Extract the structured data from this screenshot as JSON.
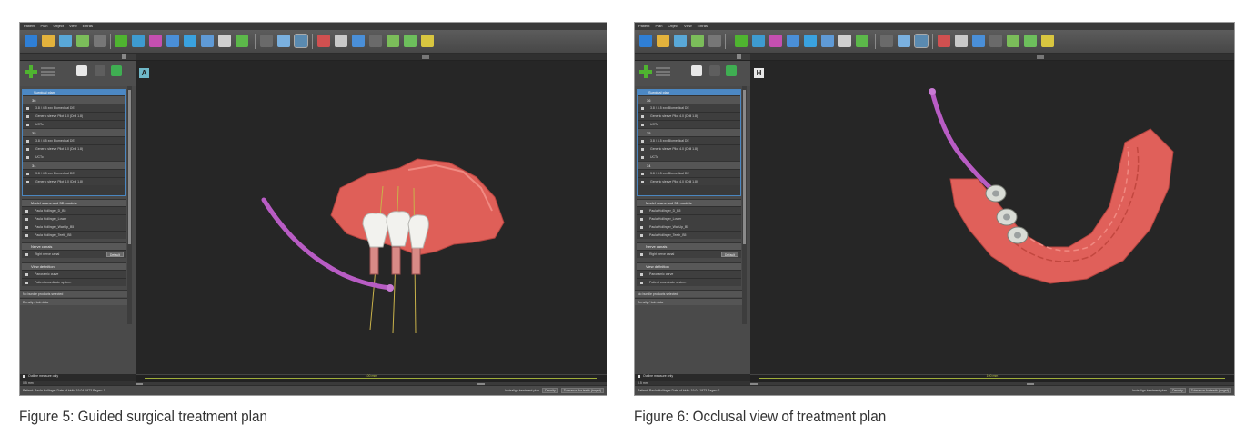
{
  "panels": [
    {
      "caption": "Figure 5: Guided surgical treatment plan",
      "view_label": "A",
      "scale_label": "100 mm",
      "unit_value": "0.5 mm",
      "checkbox_label": "Outline measure only",
      "menu": [
        "Patient",
        "Plan",
        "Object",
        "View",
        "Extras"
      ],
      "tab_label": "Plan",
      "plan_header": "Surgical plan",
      "groups": [
        {
          "label": "36",
          "rows": [
            "3.8 / 4.5  xxx Biomedical DE",
            "Generic sleeve Pilot 4.0 (Drill 1.8)",
            "UCTo"
          ]
        },
        {
          "label": "35",
          "rows": [
            "3.8 / 4.5  xxx Biomedical DE",
            "Generic sleeve Pilot 4.0 (Drill 1.8)",
            "UCTo"
          ]
        },
        {
          "label": "34",
          "rows": [
            "3.8 / 4.5  xxx Biomedical DE",
            "Generic sleeve Pilot 4.0 (Drill 1.8)",
            "UCTo"
          ]
        }
      ],
      "model_header": "Model scans and 3D models",
      "models": [
        "Paula Hollinger_D_B5",
        "Paula Hollinger_Lower",
        "Paula Hollinger_WaxUp_B5",
        "Paula Hollinger_Teeth_B5"
      ],
      "nerve_header": "Nerve canals",
      "nerve_row": "Right nerve canal",
      "default_button": "Default",
      "view_header": "View definition",
      "view_rows": [
        "Panoramic curve",
        "Patient coordinate system"
      ],
      "collapsed": [
        "No bundle products selected",
        "Density / Lab data"
      ],
      "status_left": "Patient: Paula Hollinger   Date of birth: 19.04.1973   Pages: 1",
      "status_right": "Invisalign treatment plan",
      "status_b1": "Density",
      "status_b2": "Tolerance for teeth (target)",
      "status_slice": "Images: 1 of 1"
    },
    {
      "caption": "Figure 6: Occlusal view of treatment plan",
      "view_label": "H",
      "scale_label": "100 mm",
      "unit_value": "0.5 mm",
      "checkbox_label": "Outline measure only",
      "menu": [
        "Patient",
        "Plan",
        "Object",
        "View",
        "Extras"
      ],
      "tab_label": "Plan",
      "plan_header": "Surgical plan",
      "groups": [
        {
          "label": "36",
          "rows": [
            "3.8 / 4.5  xxx Biomedical DE",
            "Generic sleeve Pilot 4.0 (Drill 1.8)",
            "UCTo"
          ]
        },
        {
          "label": "35",
          "rows": [
            "3.8 / 4.5  xxx Biomedical DE",
            "Generic sleeve Pilot 4.0 (Drill 1.8)",
            "UCTo"
          ]
        },
        {
          "label": "34",
          "rows": [
            "3.8 / 4.5  xxx Biomedical DE",
            "Generic sleeve Pilot 4.0 (Drill 1.8)",
            "UCTo"
          ]
        }
      ],
      "model_header": "Model scans and 3D models",
      "models": [
        "Paula Hollinger_D_B5",
        "Paula Hollinger_Lower",
        "Paula Hollinger_WaxUp_B5",
        "Paula Hollinger_Teeth_B5"
      ],
      "nerve_header": "Nerve canals",
      "nerve_row": "Right nerve canal",
      "default_button": "Default",
      "view_header": "View definition",
      "view_rows": [
        "Panoramic curve",
        "Patient coordinate system"
      ],
      "collapsed": [
        "No bundle products selected",
        "Density / Lab data"
      ],
      "status_left": "Patient: Paula Hollinger   Date of birth: 19.04.1973   Pages: 1",
      "status_right": "Invisalign treatment plan",
      "status_b1": "Density",
      "status_b2": "Tolerance for teeth (target)",
      "status_slice": "Images: 1 of 1"
    }
  ],
  "colors": {
    "jaw": "#e0605a",
    "nerve": "#b85cc4",
    "accent": "#4c88c4",
    "green": "#4fb430"
  },
  "toolbar_icons": [
    "back-icon",
    "open-folder-icon",
    "save-icon",
    "import-icon",
    "implant-icon",
    "sleeve-icon",
    "abutment-icon",
    "measure-icon",
    "nerve-icon",
    "export-icon",
    "settings-icon"
  ]
}
